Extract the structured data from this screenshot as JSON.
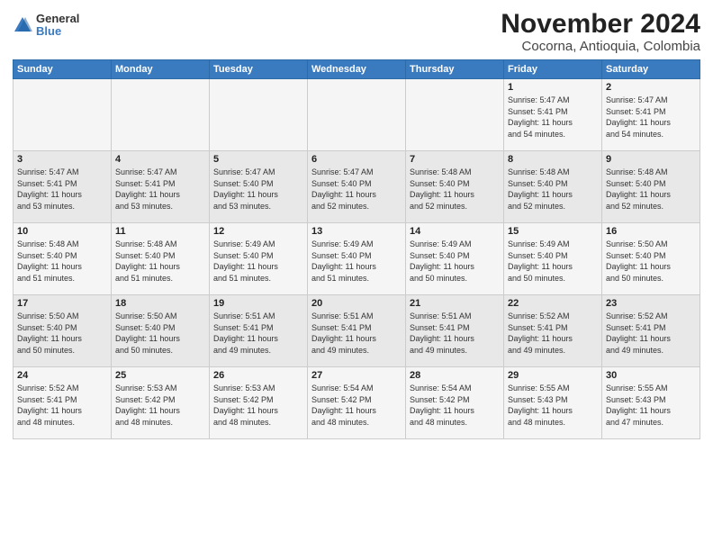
{
  "header": {
    "logo": {
      "general": "General",
      "blue": "Blue"
    },
    "title": "November 2024",
    "subtitle": "Cocorna, Antioquia, Colombia"
  },
  "calendar": {
    "days_of_week": [
      "Sunday",
      "Monday",
      "Tuesday",
      "Wednesday",
      "Thursday",
      "Friday",
      "Saturday"
    ],
    "weeks": [
      [
        {
          "day": "",
          "info": ""
        },
        {
          "day": "",
          "info": ""
        },
        {
          "day": "",
          "info": ""
        },
        {
          "day": "",
          "info": ""
        },
        {
          "day": "",
          "info": ""
        },
        {
          "day": "1",
          "info": "Sunrise: 5:47 AM\nSunset: 5:41 PM\nDaylight: 11 hours\nand 54 minutes."
        },
        {
          "day": "2",
          "info": "Sunrise: 5:47 AM\nSunset: 5:41 PM\nDaylight: 11 hours\nand 54 minutes."
        }
      ],
      [
        {
          "day": "3",
          "info": "Sunrise: 5:47 AM\nSunset: 5:41 PM\nDaylight: 11 hours\nand 53 minutes."
        },
        {
          "day": "4",
          "info": "Sunrise: 5:47 AM\nSunset: 5:41 PM\nDaylight: 11 hours\nand 53 minutes."
        },
        {
          "day": "5",
          "info": "Sunrise: 5:47 AM\nSunset: 5:40 PM\nDaylight: 11 hours\nand 53 minutes."
        },
        {
          "day": "6",
          "info": "Sunrise: 5:47 AM\nSunset: 5:40 PM\nDaylight: 11 hours\nand 52 minutes."
        },
        {
          "day": "7",
          "info": "Sunrise: 5:48 AM\nSunset: 5:40 PM\nDaylight: 11 hours\nand 52 minutes."
        },
        {
          "day": "8",
          "info": "Sunrise: 5:48 AM\nSunset: 5:40 PM\nDaylight: 11 hours\nand 52 minutes."
        },
        {
          "day": "9",
          "info": "Sunrise: 5:48 AM\nSunset: 5:40 PM\nDaylight: 11 hours\nand 52 minutes."
        }
      ],
      [
        {
          "day": "10",
          "info": "Sunrise: 5:48 AM\nSunset: 5:40 PM\nDaylight: 11 hours\nand 51 minutes."
        },
        {
          "day": "11",
          "info": "Sunrise: 5:48 AM\nSunset: 5:40 PM\nDaylight: 11 hours\nand 51 minutes."
        },
        {
          "day": "12",
          "info": "Sunrise: 5:49 AM\nSunset: 5:40 PM\nDaylight: 11 hours\nand 51 minutes."
        },
        {
          "day": "13",
          "info": "Sunrise: 5:49 AM\nSunset: 5:40 PM\nDaylight: 11 hours\nand 51 minutes."
        },
        {
          "day": "14",
          "info": "Sunrise: 5:49 AM\nSunset: 5:40 PM\nDaylight: 11 hours\nand 50 minutes."
        },
        {
          "day": "15",
          "info": "Sunrise: 5:49 AM\nSunset: 5:40 PM\nDaylight: 11 hours\nand 50 minutes."
        },
        {
          "day": "16",
          "info": "Sunrise: 5:50 AM\nSunset: 5:40 PM\nDaylight: 11 hours\nand 50 minutes."
        }
      ],
      [
        {
          "day": "17",
          "info": "Sunrise: 5:50 AM\nSunset: 5:40 PM\nDaylight: 11 hours\nand 50 minutes."
        },
        {
          "day": "18",
          "info": "Sunrise: 5:50 AM\nSunset: 5:40 PM\nDaylight: 11 hours\nand 50 minutes."
        },
        {
          "day": "19",
          "info": "Sunrise: 5:51 AM\nSunset: 5:41 PM\nDaylight: 11 hours\nand 49 minutes."
        },
        {
          "day": "20",
          "info": "Sunrise: 5:51 AM\nSunset: 5:41 PM\nDaylight: 11 hours\nand 49 minutes."
        },
        {
          "day": "21",
          "info": "Sunrise: 5:51 AM\nSunset: 5:41 PM\nDaylight: 11 hours\nand 49 minutes."
        },
        {
          "day": "22",
          "info": "Sunrise: 5:52 AM\nSunset: 5:41 PM\nDaylight: 11 hours\nand 49 minutes."
        },
        {
          "day": "23",
          "info": "Sunrise: 5:52 AM\nSunset: 5:41 PM\nDaylight: 11 hours\nand 49 minutes."
        }
      ],
      [
        {
          "day": "24",
          "info": "Sunrise: 5:52 AM\nSunset: 5:41 PM\nDaylight: 11 hours\nand 48 minutes."
        },
        {
          "day": "25",
          "info": "Sunrise: 5:53 AM\nSunset: 5:42 PM\nDaylight: 11 hours\nand 48 minutes."
        },
        {
          "day": "26",
          "info": "Sunrise: 5:53 AM\nSunset: 5:42 PM\nDaylight: 11 hours\nand 48 minutes."
        },
        {
          "day": "27",
          "info": "Sunrise: 5:54 AM\nSunset: 5:42 PM\nDaylight: 11 hours\nand 48 minutes."
        },
        {
          "day": "28",
          "info": "Sunrise: 5:54 AM\nSunset: 5:42 PM\nDaylight: 11 hours\nand 48 minutes."
        },
        {
          "day": "29",
          "info": "Sunrise: 5:55 AM\nSunset: 5:43 PM\nDaylight: 11 hours\nand 48 minutes."
        },
        {
          "day": "30",
          "info": "Sunrise: 5:55 AM\nSunset: 5:43 PM\nDaylight: 11 hours\nand 47 minutes."
        }
      ]
    ]
  }
}
